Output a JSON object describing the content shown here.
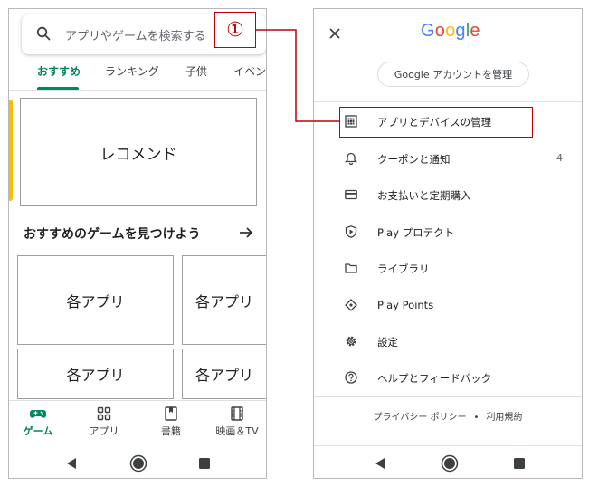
{
  "left": {
    "search": {
      "placeholder": "アプリやゲームを検索する",
      "icon": "search-icon"
    },
    "tabs": [
      {
        "label": "おすすめ",
        "active": true
      },
      {
        "label": "ランキング"
      },
      {
        "label": "子供"
      },
      {
        "label": "イベン"
      }
    ],
    "recommend_label": "レコメンド",
    "section": {
      "title": "おすすめのゲームを見つけよう",
      "arrow_icon": "arrow-right-icon"
    },
    "apps": [
      "各アプリ",
      "各アプリ",
      "各アプリ",
      "各アプリ"
    ],
    "bottom_nav": [
      {
        "label": "ゲーム",
        "icon": "gamepad-icon",
        "active": true
      },
      {
        "label": "アプリ",
        "icon": "apps-grid-icon"
      },
      {
        "label": "書籍",
        "icon": "bookmark-icon"
      },
      {
        "label": "映画＆TV",
        "icon": "film-icon"
      }
    ],
    "system_nav": [
      "back-icon",
      "home-icon",
      "recents-icon"
    ]
  },
  "right": {
    "close_icon": "close-icon",
    "logo": {
      "letters": [
        "G",
        "o",
        "o",
        "g",
        "l",
        "e"
      ],
      "colors": [
        "#4285F4",
        "#EA4335",
        "#FBBC05",
        "#4285F4",
        "#34A853",
        "#EA4335"
      ]
    },
    "manage_account_label": "Google アカウントを管理",
    "menu": [
      {
        "label": "アプリとデバイスの管理",
        "icon": "grid-icon"
      },
      {
        "label": "クーポンと通知",
        "icon": "bell-icon",
        "badge": "4"
      },
      {
        "label": "お支払いと定期購入",
        "icon": "card-icon"
      },
      {
        "label": "Play プロテクト",
        "icon": "shield-play-icon"
      },
      {
        "label": "ライブラリ",
        "icon": "folder-icon"
      },
      {
        "label": "Play Points",
        "icon": "diamond-icon"
      },
      {
        "label": "設定",
        "icon": "gear-icon"
      },
      {
        "label": "ヘルプとフィードバック",
        "icon": "help-icon"
      }
    ],
    "footer": {
      "privacy": "プライバシー ポリシー",
      "separator": "•",
      "terms": "利用規約"
    },
    "system_nav": [
      "back-icon",
      "home-icon",
      "recents-icon"
    ]
  },
  "annotation": {
    "marker": "①",
    "color": "#c00000"
  },
  "colors": {
    "accent_green": "#01875f",
    "annotation_red": "#c00000"
  }
}
